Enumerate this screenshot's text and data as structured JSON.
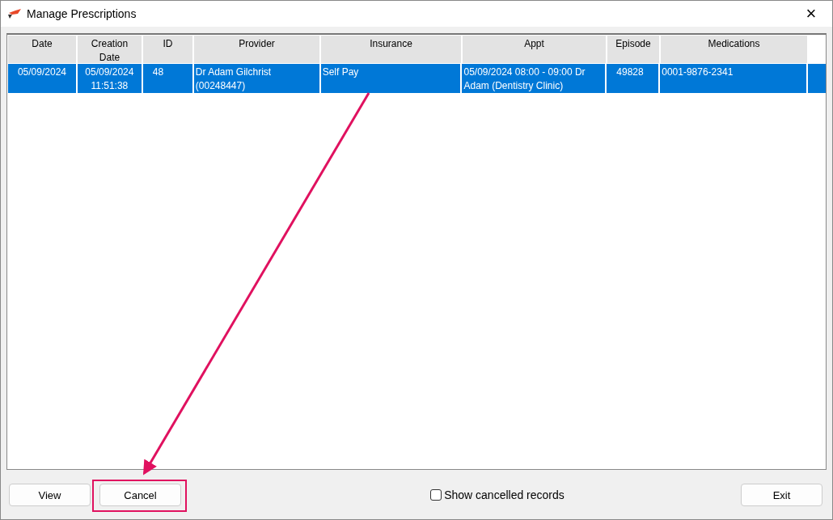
{
  "window": {
    "title": "Manage Prescriptions",
    "close": "×"
  },
  "table": {
    "columns": [
      "Date",
      "Creation Date",
      "ID",
      "Provider",
      "Insurance",
      "Appt",
      "Episode",
      "Medications"
    ],
    "rows": [
      {
        "selected": true,
        "cells": [
          "05/09/2024",
          "05/09/2024 11:51:38",
          "48",
          "Dr Adam Gilchrist (00248447)",
          "Self Pay",
          "05/09/2024 08:00 - 09:00 Dr Adam (Dentistry Clinic)",
          "49828",
          "0001-9876-2341"
        ]
      }
    ]
  },
  "buttons": [
    {
      "label": "View",
      "highlighted": false
    },
    {
      "label": "Cancel",
      "highlighted": true
    },
    {
      "label": "Exit",
      "highlighted": false
    }
  ],
  "show_cancelled": {
    "label": "Show cancelled records",
    "checked": false
  }
}
